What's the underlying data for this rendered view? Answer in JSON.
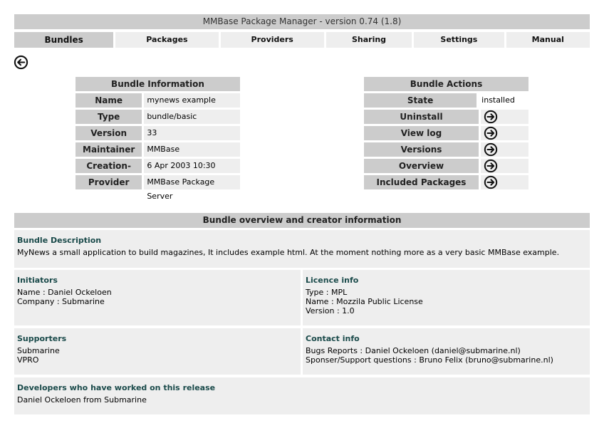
{
  "title": "MMBase Package Manager - version 0.74 (1.8)",
  "nav": [
    {
      "label": "Bundles",
      "w": 140,
      "active": true
    },
    {
      "label": "Packages",
      "w": 145
    },
    {
      "label": "Providers",
      "w": 146
    },
    {
      "label": "Sharing",
      "w": 121
    },
    {
      "label": "Settings",
      "w": 127
    },
    {
      "label": "Manual",
      "w": 118
    }
  ],
  "bundle_info": {
    "heading": "Bundle Information",
    "rows": [
      {
        "label": "Name",
        "value": "mynews example"
      },
      {
        "label": "Type",
        "value": "bundle/basic"
      },
      {
        "label": "Version",
        "value": "33"
      },
      {
        "label": "Maintainer",
        "value": "MMBase"
      },
      {
        "label": "Creation-Date",
        "value": "6 Apr 2003 10:30"
      },
      {
        "label": "Provider",
        "value": "MMBase Package Server"
      }
    ]
  },
  "bundle_actions": {
    "heading": "Bundle Actions",
    "state_label": "State",
    "state_value": "installed",
    "actions": [
      "Uninstall",
      "View log",
      "Versions",
      "Overview",
      "Included Packages"
    ]
  },
  "overview": {
    "heading": "Bundle overview and creator information",
    "description_title": "Bundle Description",
    "description": "MyNews a small application to build magazines, It includes example html. At the moment nothing more as a very basic MMBase example.",
    "initiators_title": "Initiators",
    "initiators": [
      "Name : Daniel Ockeloen",
      "Company : Submarine"
    ],
    "licence_title": "Licence info",
    "licence": [
      "Type : MPL",
      "Name : Mozzila Public License",
      "Version : 1.0"
    ],
    "supporters_title": "Supporters",
    "supporters": [
      "Submarine",
      "VPRO"
    ],
    "contact_title": "Contact info",
    "contact": [
      "Bugs Reports : Daniel Ockeloen (daniel@submarine.nl)",
      "Sponser/Support questions : Bruno Felix (bruno@submarine.nl)"
    ],
    "developers_title": "Developers who have worked on this release",
    "developers": [
      "Daniel Ockeloen from Submarine"
    ]
  }
}
